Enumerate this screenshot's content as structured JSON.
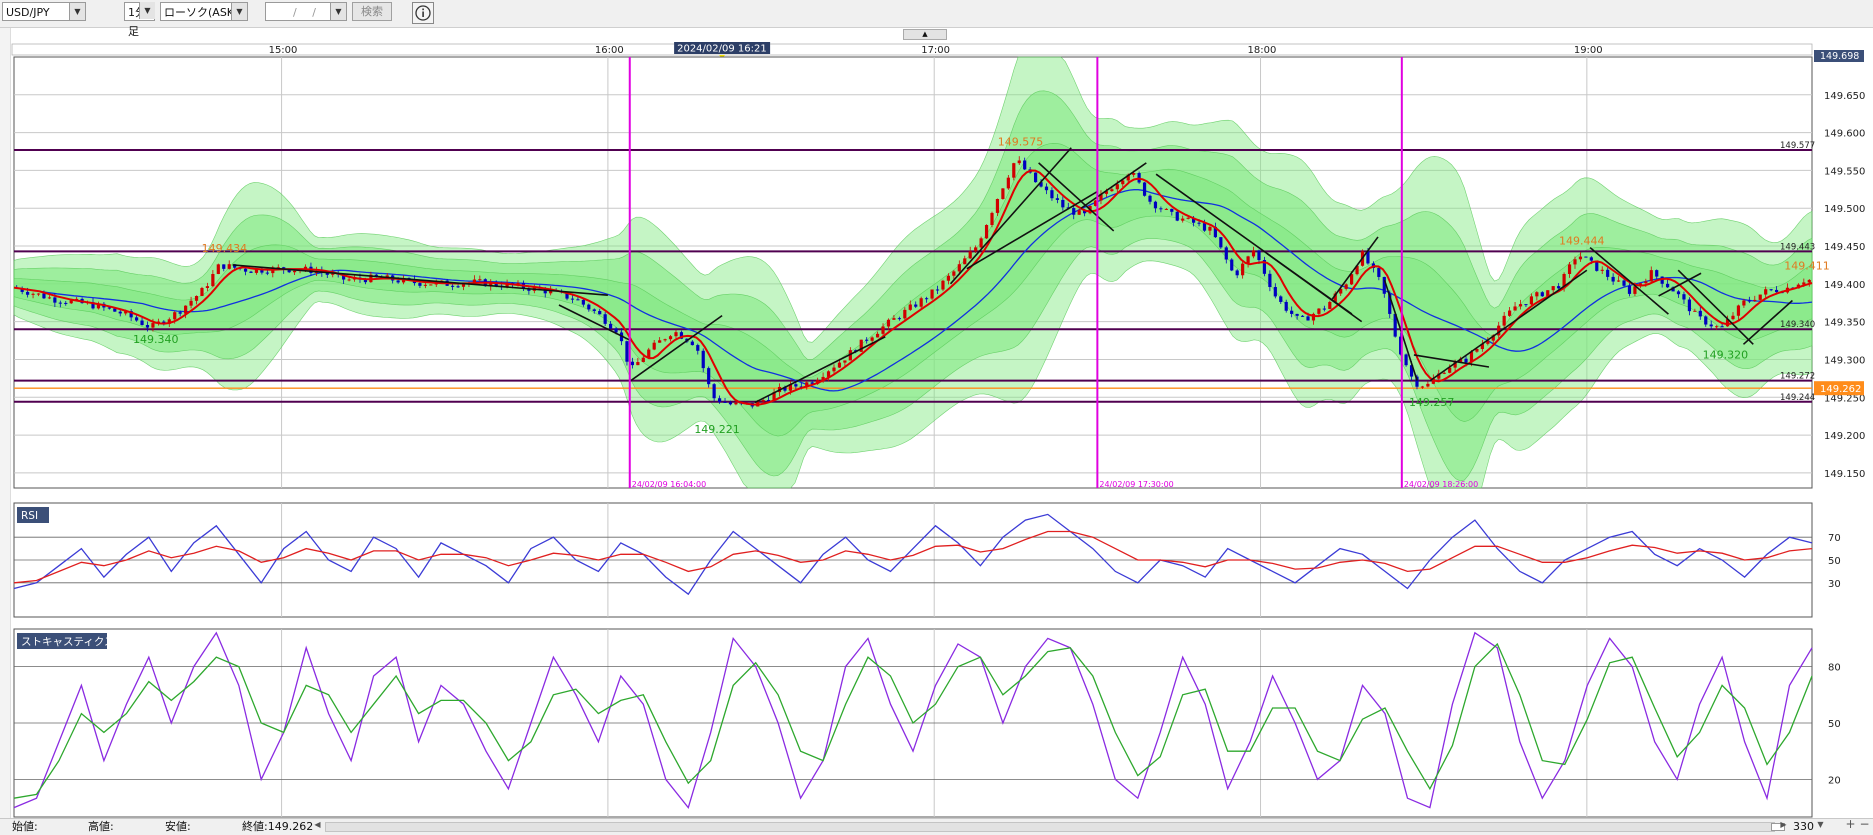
{
  "toolbar": {
    "symbol": "USD/JPY",
    "timeframe": "1分足",
    "chart_style": "ローソク(ASK)",
    "date_input": "/ /",
    "search_label": "検索",
    "info_icon": "info-icon"
  },
  "status_bar": {
    "open_label": "始値:",
    "high_label": "高値:",
    "low_label": "安値:",
    "close_label": "終値:149.262",
    "bars_count": "330"
  },
  "colors": {
    "candle_up": "#d00000",
    "candle_down": "#0000c0",
    "ma_fast": "#e00000",
    "ma_slow": "#1030e0",
    "band_fill": "#7ee87e",
    "marker_line": "#e000e0",
    "price_line": "#500050",
    "current_price": "#ff8c1a",
    "rsi_fast": "#3b3bd6",
    "rsi_slow": "#e02020",
    "stoch_k": "#8a2be2",
    "stoch_d": "#2ea82e"
  },
  "chart_data": [
    {
      "type": "line",
      "panel": "price",
      "chart_style": "candlestick",
      "x_ticks": [
        "15:00",
        "16:00",
        "17:00",
        "18:00",
        "19:00"
      ],
      "cursor_time": "2024/02/09 16:21",
      "y_ticks": [
        "149.150",
        "149.200",
        "149.250",
        "149.300",
        "149.350",
        "149.400",
        "149.450",
        "149.500",
        "149.550",
        "149.600",
        "149.650"
      ],
      "ylim": [
        149.13,
        149.7
      ],
      "top_price_label": "149.698",
      "current_price": "149.262",
      "key_points": [
        {
          "t": 14.6,
          "price": 149.34,
          "label": "149.340",
          "kind": "low"
        },
        {
          "t": 14.81,
          "price": 149.434,
          "label": "149.434",
          "kind": "high"
        },
        {
          "t": 16.32,
          "price": 149.221,
          "label": "149.221",
          "kind": "low"
        },
        {
          "t": 17.25,
          "price": 149.575,
          "label": "149.575",
          "kind": "high"
        },
        {
          "t": 18.51,
          "price": 149.257,
          "label": "149.257",
          "kind": "low"
        },
        {
          "t": 18.97,
          "price": 149.444,
          "label": "149.444",
          "kind": "high"
        },
        {
          "t": 19.41,
          "price": 149.32,
          "label": "149.320",
          "kind": "low"
        },
        {
          "t": 19.66,
          "price": 149.411,
          "label": "149.411",
          "kind": "high"
        }
      ],
      "horizontal_lines": [
        {
          "price": 149.577,
          "label": "149.577"
        },
        {
          "price": 149.443,
          "label": "149.443"
        },
        {
          "price": 149.34,
          "label": "149.340"
        },
        {
          "price": 149.272,
          "label": "149.272"
        },
        {
          "price": 149.244,
          "label": "149.244"
        }
      ],
      "vertical_markers": [
        {
          "t": 16.067,
          "label": "24/02/09 16:04:00"
        },
        {
          "t": 17.5,
          "label": "24/02/09 17:30:00"
        },
        {
          "t": 18.433,
          "label": "24/02/09 18:26:00"
        }
      ],
      "price_path": [
        [
          14.18,
          149.395
        ],
        [
          14.3,
          149.38
        ],
        [
          14.42,
          149.372
        ],
        [
          14.52,
          149.36
        ],
        [
          14.6,
          149.342
        ],
        [
          14.68,
          149.362
        ],
        [
          14.76,
          149.392
        ],
        [
          14.81,
          149.425
        ],
        [
          14.9,
          149.418
        ],
        [
          15.0,
          149.42
        ],
        [
          15.1,
          149.418
        ],
        [
          15.2,
          149.405
        ],
        [
          15.3,
          149.408
        ],
        [
          15.4,
          149.402
        ],
        [
          15.5,
          149.4
        ],
        [
          15.6,
          149.402
        ],
        [
          15.7,
          149.398
        ],
        [
          15.8,
          149.392
        ],
        [
          15.9,
          149.38
        ],
        [
          15.97,
          149.36
        ],
        [
          16.03,
          149.338
        ],
        [
          16.07,
          149.285
        ],
        [
          16.12,
          149.31
        ],
        [
          16.2,
          149.338
        ],
        [
          16.27,
          149.32
        ],
        [
          16.32,
          149.25
        ],
        [
          16.38,
          149.24
        ],
        [
          16.45,
          149.24
        ],
        [
          16.53,
          149.26
        ],
        [
          16.62,
          149.27
        ],
        [
          16.72,
          149.3
        ],
        [
          16.8,
          149.33
        ],
        [
          16.9,
          149.36
        ],
        [
          17.0,
          149.39
        ],
        [
          17.07,
          149.42
        ],
        [
          17.13,
          149.45
        ],
        [
          17.2,
          149.52
        ],
        [
          17.25,
          149.565
        ],
        [
          17.32,
          149.53
        ],
        [
          17.4,
          149.5
        ],
        [
          17.46,
          149.49
        ],
        [
          17.52,
          149.52
        ],
        [
          17.6,
          149.55
        ],
        [
          17.66,
          149.51
        ],
        [
          17.73,
          149.49
        ],
        [
          17.8,
          149.48
        ],
        [
          17.85,
          149.47
        ],
        [
          17.92,
          149.41
        ],
        [
          17.98,
          149.445
        ],
        [
          18.05,
          149.38
        ],
        [
          18.12,
          149.35
        ],
        [
          18.2,
          149.37
        ],
        [
          18.26,
          149.4
        ],
        [
          18.31,
          149.44
        ],
        [
          18.37,
          149.4
        ],
        [
          18.42,
          149.32
        ],
        [
          18.47,
          149.27
        ],
        [
          18.51,
          149.265
        ],
        [
          18.57,
          149.29
        ],
        [
          18.63,
          149.3
        ],
        [
          18.7,
          149.33
        ],
        [
          18.78,
          149.37
        ],
        [
          18.85,
          149.385
        ],
        [
          18.92,
          149.4
        ],
        [
          18.97,
          149.44
        ],
        [
          19.05,
          149.415
        ],
        [
          19.13,
          149.39
        ],
        [
          19.2,
          149.415
        ],
        [
          19.27,
          149.39
        ],
        [
          19.34,
          149.355
        ],
        [
          19.41,
          149.34
        ],
        [
          19.48,
          149.375
        ],
        [
          19.55,
          149.39
        ],
        [
          19.62,
          149.395
        ],
        [
          19.66,
          149.405
        ]
      ]
    },
    {
      "type": "line",
      "panel": "rsi",
      "title": "RSI",
      "y_ticks": [
        "30",
        "50",
        "70"
      ],
      "ylim": [
        0,
        100
      ],
      "series": [
        {
          "values": [
            25,
            30,
            45,
            60,
            35,
            55,
            70,
            40,
            65,
            80,
            55,
            30,
            60,
            75,
            50,
            40,
            70,
            60,
            35,
            65,
            55,
            45,
            30,
            60,
            70,
            50,
            40,
            65,
            55,
            35,
            20,
            50,
            75,
            60,
            45,
            30,
            55,
            70,
            50,
            40,
            60,
            80,
            65,
            45,
            70,
            85,
            90,
            75,
            60,
            40,
            30,
            50,
            45,
            35,
            60,
            50,
            40,
            30,
            45,
            60,
            55,
            40,
            25,
            50,
            70,
            85,
            60,
            40,
            30,
            50,
            60,
            70,
            75,
            55,
            45,
            60,
            50,
            35,
            55,
            70,
            65
          ]
        },
        {
          "values": [
            30,
            32,
            40,
            48,
            45,
            50,
            58,
            52,
            56,
            62,
            58,
            48,
            52,
            60,
            56,
            50,
            58,
            58,
            50,
            55,
            55,
            52,
            45,
            50,
            56,
            54,
            50,
            55,
            55,
            48,
            40,
            44,
            55,
            58,
            54,
            48,
            50,
            58,
            55,
            50,
            54,
            62,
            63,
            57,
            60,
            68,
            75,
            75,
            70,
            60,
            50,
            50,
            48,
            44,
            50,
            50,
            47,
            42,
            43,
            48,
            50,
            47,
            40,
            42,
            52,
            62,
            62,
            55,
            48,
            48,
            52,
            58,
            63,
            61,
            56,
            58,
            56,
            50,
            52,
            58,
            60
          ]
        }
      ]
    },
    {
      "type": "line",
      "panel": "stochastics",
      "title": "ストキャスティクス",
      "y_ticks": [
        "20",
        "50",
        "80"
      ],
      "ylim": [
        0,
        100
      ],
      "series": [
        {
          "values": [
            5,
            10,
            40,
            70,
            30,
            60,
            85,
            50,
            80,
            98,
            70,
            20,
            45,
            90,
            55,
            30,
            75,
            85,
            40,
            70,
            60,
            35,
            15,
            50,
            85,
            65,
            40,
            75,
            60,
            20,
            5,
            45,
            95,
            80,
            50,
            10,
            30,
            80,
            95,
            60,
            35,
            70,
            92,
            85,
            50,
            80,
            95,
            90,
            60,
            20,
            10,
            45,
            85,
            60,
            15,
            40,
            75,
            50,
            20,
            30,
            70,
            55,
            10,
            5,
            60,
            98,
            90,
            40,
            10,
            30,
            70,
            95,
            80,
            40,
            20,
            60,
            85,
            40,
            10,
            70,
            90
          ]
        },
        {
          "values": [
            10,
            12,
            30,
            55,
            45,
            55,
            72,
            62,
            72,
            85,
            80,
            50,
            45,
            70,
            65,
            45,
            60,
            75,
            55,
            62,
            62,
            50,
            30,
            40,
            65,
            68,
            55,
            62,
            65,
            40,
            18,
            30,
            70,
            82,
            65,
            35,
            30,
            60,
            85,
            75,
            50,
            60,
            80,
            85,
            65,
            75,
            88,
            90,
            75,
            45,
            22,
            32,
            65,
            68,
            35,
            35,
            58,
            58,
            35,
            30,
            52,
            58,
            35,
            15,
            38,
            80,
            92,
            65,
            30,
            28,
            52,
            82,
            85,
            58,
            32,
            45,
            70,
            58,
            28,
            45,
            75
          ]
        }
      ]
    }
  ]
}
